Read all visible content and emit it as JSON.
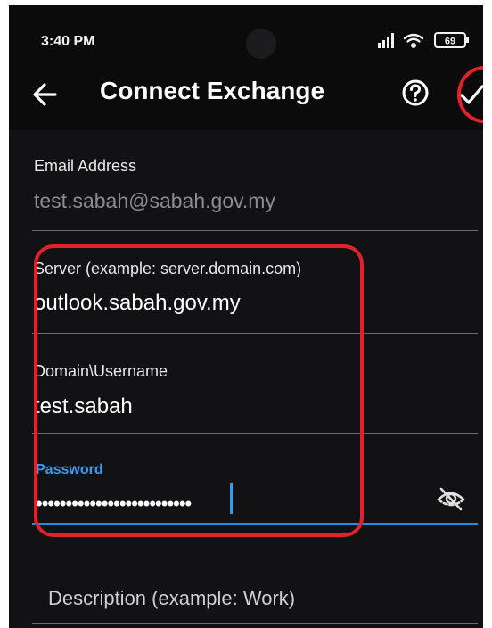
{
  "status_bar": {
    "time": "3:40 PM",
    "battery": "69"
  },
  "header": {
    "title": "Connect Exchange",
    "back_icon": "back-arrow-icon",
    "help_icon": "help-circle-icon",
    "confirm_icon": "checkmark-icon"
  },
  "form": {
    "email": {
      "label": "Email Address",
      "value": "test.sabah@sabah.gov.my"
    },
    "server": {
      "label": "Server (example: server.domain.com)",
      "value": "outlook.sabah.gov.my"
    },
    "username": {
      "label": "Domain\\Username",
      "value": "test.sabah"
    },
    "password": {
      "label": "Password",
      "value_masked": "••••••••••••••••••••••••••",
      "toggle_icon": "eye-off-icon"
    },
    "description": {
      "placeholder": "Description (example: Work)"
    }
  },
  "colors": {
    "accent": "#1e8fe8",
    "annotation": "#e1212b",
    "background": "#121214"
  }
}
